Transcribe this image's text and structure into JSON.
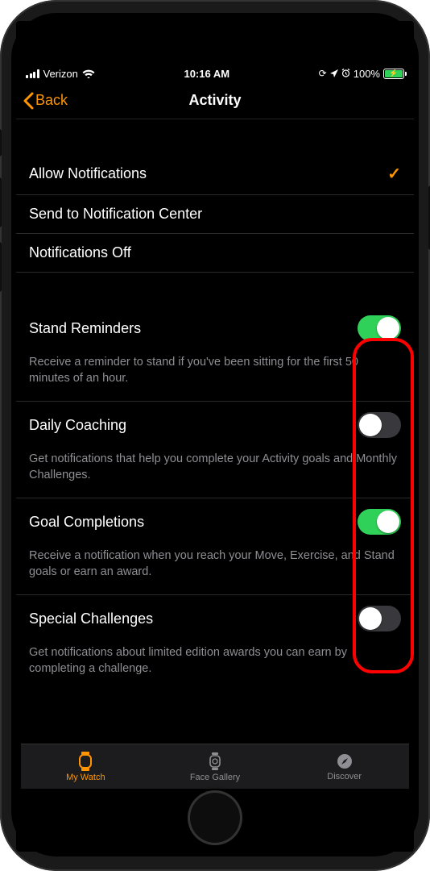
{
  "status": {
    "carrier": "Verizon",
    "time": "10:16 AM",
    "battery_pct": "100%"
  },
  "nav": {
    "back": "Back",
    "title": "Activity"
  },
  "notif_options": [
    {
      "label": "Allow Notifications",
      "checked": true
    },
    {
      "label": "Send to Notification Center",
      "checked": false
    },
    {
      "label": "Notifications Off",
      "checked": false
    }
  ],
  "settings": [
    {
      "title": "Stand Reminders",
      "desc": "Receive a reminder to stand if you've been sitting for the first 50 minutes of an hour.",
      "on": true
    },
    {
      "title": "Daily Coaching",
      "desc": "Get notifications that help you complete your Activity goals and Monthly Challenges.",
      "on": false
    },
    {
      "title": "Goal Completions",
      "desc": "Receive a notification when you reach your Move, Exercise, and Stand goals or earn an award.",
      "on": true
    },
    {
      "title": "Special Challenges",
      "desc": "Get notifications about limited edition awards you can earn by completing a challenge.",
      "on": false
    }
  ],
  "tabs": {
    "mywatch": "My Watch",
    "facegallery": "Face Gallery",
    "discover": "Discover"
  }
}
